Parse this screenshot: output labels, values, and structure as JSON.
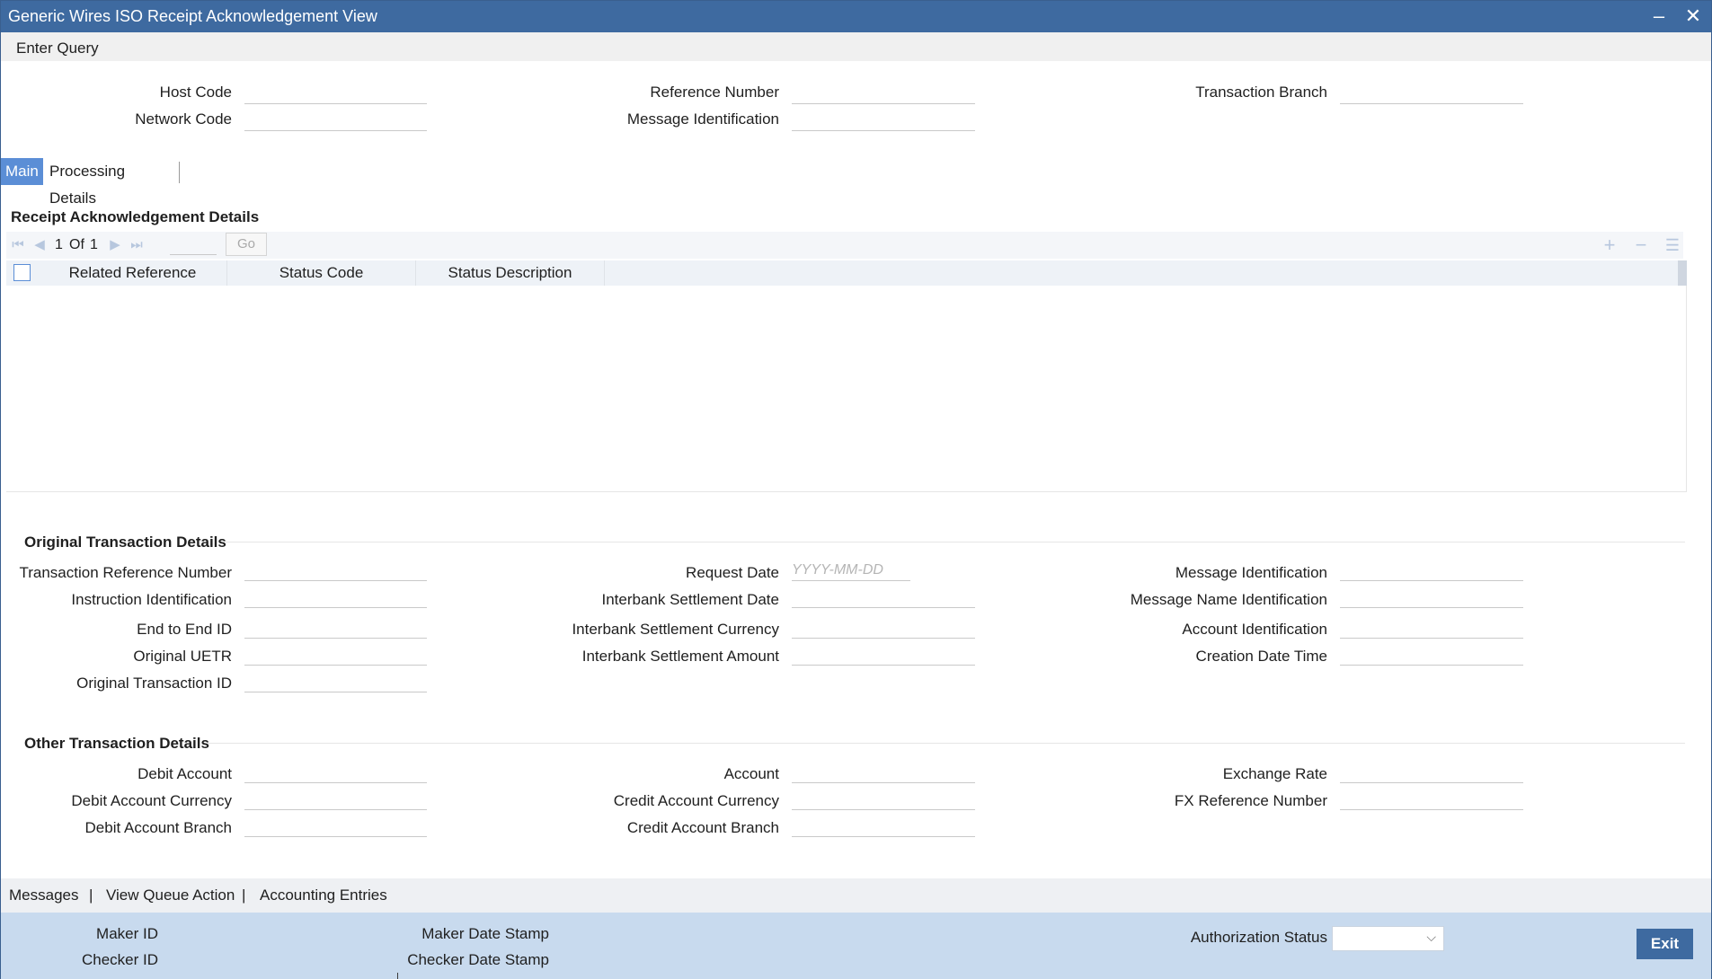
{
  "window": {
    "title": "Generic Wires ISO Receipt Acknowledgement View",
    "minimize_icon": "minimize-icon",
    "close_icon": "close-icon"
  },
  "toolbar": {
    "enter_query": "Enter Query"
  },
  "header_fields": {
    "host_code": {
      "label": "Host Code",
      "value": ""
    },
    "network_code": {
      "label": "Network Code",
      "value": ""
    },
    "reference_number": {
      "label": "Reference Number",
      "value": ""
    },
    "message_identification": {
      "label": "Message Identification",
      "value": ""
    },
    "transaction_branch": {
      "label": "Transaction Branch",
      "value": ""
    }
  },
  "tabs": [
    {
      "label": "Main",
      "active": true
    },
    {
      "label": "Processing Details",
      "active": false
    }
  ],
  "receipt_section": {
    "title": "Receipt Acknowledgement Details",
    "pagination": {
      "current": "1",
      "of_label": "Of",
      "total": "1",
      "go_label": "Go"
    },
    "columns": [
      "Related Reference",
      "Status Code",
      "Status Description"
    ],
    "rows": []
  },
  "original_section": {
    "title": "Original Transaction Details",
    "transaction_reference_number": {
      "label": "Transaction Reference Number",
      "value": ""
    },
    "instruction_identification": {
      "label": "Instruction Identification",
      "value": ""
    },
    "end_to_end_id": {
      "label": "End to End ID",
      "value": ""
    },
    "original_uetr": {
      "label": "Original UETR",
      "value": ""
    },
    "original_transaction_id": {
      "label": "Original Transaction ID",
      "value": ""
    },
    "request_date": {
      "label": "Request Date",
      "value": "",
      "placeholder": "YYYY-MM-DD"
    },
    "interbank_settlement_date": {
      "label": "Interbank Settlement Date",
      "value": ""
    },
    "interbank_settlement_currency": {
      "label": "Interbank Settlement Currency",
      "value": ""
    },
    "interbank_settlement_amount": {
      "label": "Interbank Settlement Amount",
      "value": ""
    },
    "message_identification": {
      "label": "Message Identification",
      "value": ""
    },
    "message_name_identification": {
      "label": "Message Name Identification",
      "value": ""
    },
    "account_identification": {
      "label": "Account Identification",
      "value": ""
    },
    "creation_date_time": {
      "label": "Creation Date Time",
      "value": ""
    }
  },
  "other_section": {
    "title": "Other Transaction Details",
    "debit_account": {
      "label": "Debit Account",
      "value": ""
    },
    "debit_account_currency": {
      "label": "Debit Account Currency",
      "value": ""
    },
    "debit_account_branch": {
      "label": "Debit Account Branch",
      "value": ""
    },
    "account": {
      "label": "Account",
      "value": ""
    },
    "credit_account_currency": {
      "label": "Credit Account Currency",
      "value": ""
    },
    "credit_account_branch": {
      "label": "Credit Account Branch",
      "value": ""
    },
    "exchange_rate": {
      "label": "Exchange Rate",
      "value": ""
    },
    "fx_reference_number": {
      "label": "FX Reference Number",
      "value": ""
    }
  },
  "footer_links": [
    "Messages",
    "View Queue Action",
    "Accounting Entries"
  ],
  "footer_separator": "|",
  "audit": {
    "maker_id": "Maker ID",
    "checker_id": "Checker ID",
    "maker_date_stamp": "Maker Date Stamp",
    "checker_date_stamp": "Checker Date Stamp",
    "authorization_status": "Authorization Status",
    "authorization_value": "",
    "exit_label": "Exit"
  },
  "colors": {
    "title_bar": "#3e6aa0",
    "active_tab": "#5b8ed6",
    "audit_panel": "#c8daee",
    "exit_button": "#3e6aa0"
  }
}
